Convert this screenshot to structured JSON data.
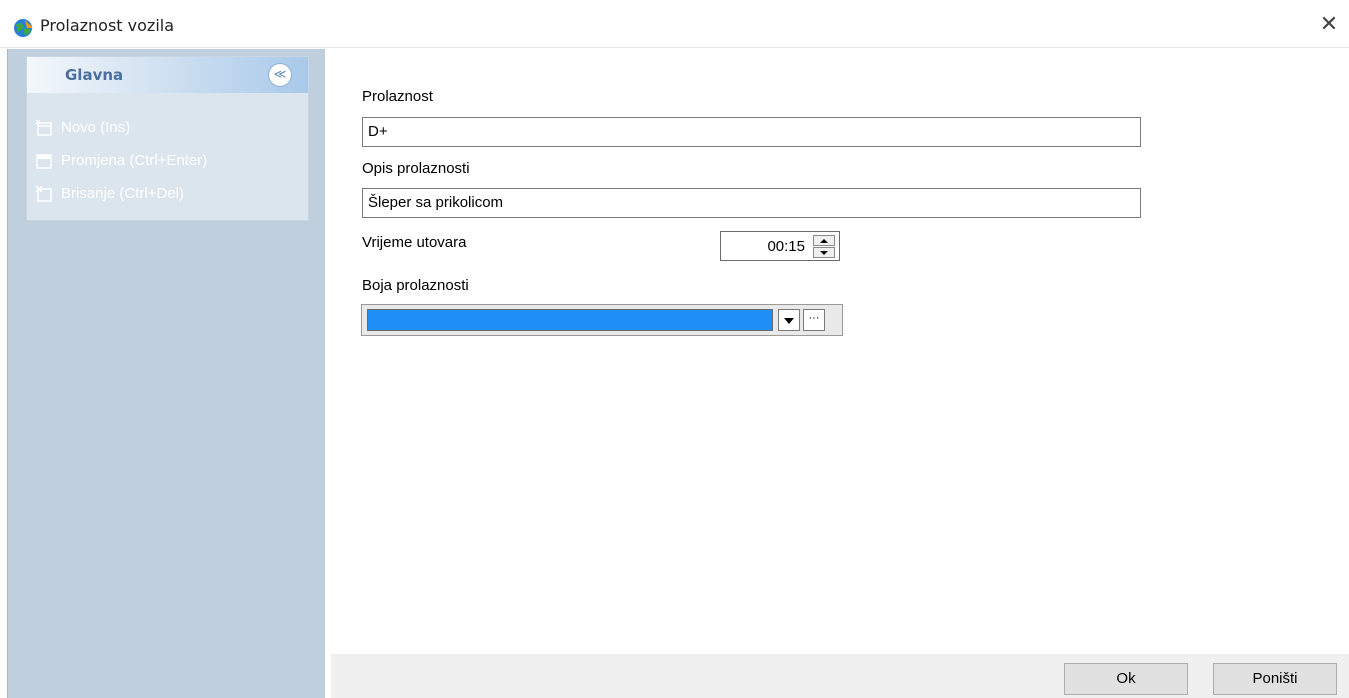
{
  "window": {
    "title": "Prolaznost vozila",
    "close_glyph": "✕",
    "icon": "app-globe-icon"
  },
  "sidebar": {
    "group_title": "Glavna",
    "collapse_glyph": "≪",
    "items": [
      {
        "label": "Novo (Ins)",
        "icon": "new-record-icon"
      },
      {
        "label": "Promjena (Ctrl+Enter)",
        "icon": "edit-record-icon"
      },
      {
        "label": "Brisanje (Ctrl+Del)",
        "icon": "delete-record-icon"
      }
    ]
  },
  "form": {
    "prolaznost_label": "Prolaznost",
    "prolaznost_value": "D+",
    "opis_label": "Opis prolaznosti",
    "opis_value": "Šleper sa prikolicom",
    "vrijeme_label": "Vrijeme utovara",
    "vrijeme_value": "00:15",
    "boja_label": "Boja prolaznosti",
    "boja_color": "#1e8ff5",
    "dots_label": "···"
  },
  "footer": {
    "ok_label": "Ok",
    "cancel_label": "Poništi"
  }
}
